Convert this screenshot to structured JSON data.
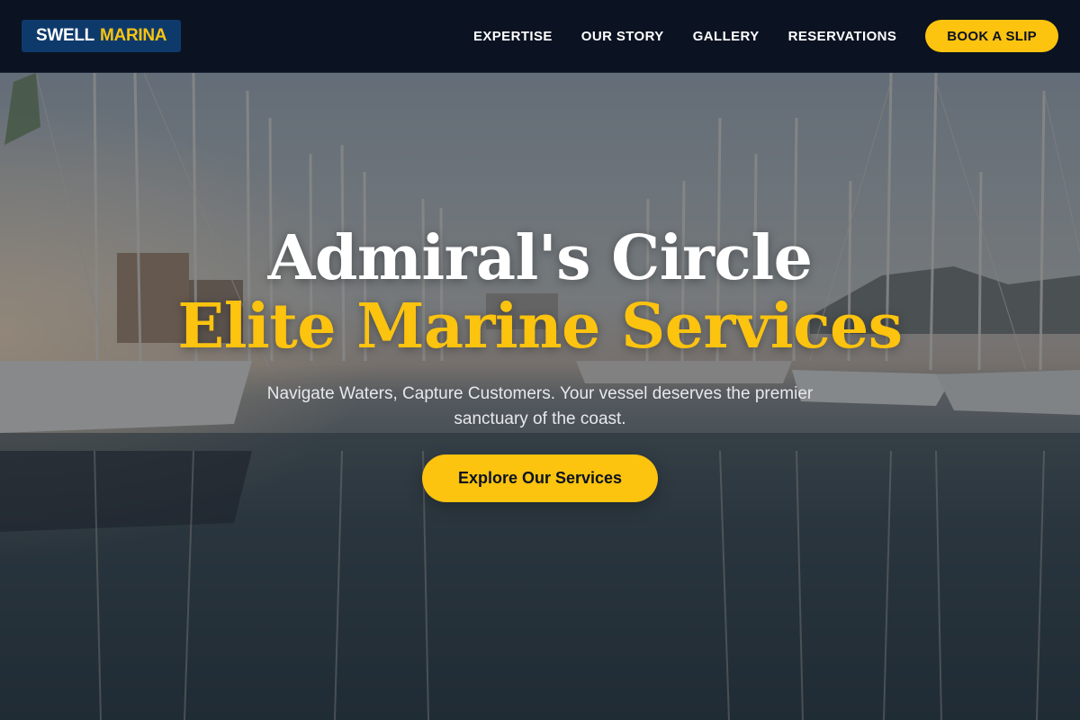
{
  "header": {
    "logo": {
      "word1": "SWELL",
      "word2": "MARINA"
    },
    "nav": [
      {
        "label": "EXPERTISE"
      },
      {
        "label": "OUR STORY"
      },
      {
        "label": "GALLERY"
      },
      {
        "label": "RESERVATIONS"
      }
    ],
    "cta_label": "BOOK A SLIP"
  },
  "hero": {
    "title_line1": "Admiral's Circle",
    "title_line2": "Elite Marine Services",
    "subtitle": "Navigate Waters, Capture Customers. Your vessel deserves the premier sanctuary of the coast.",
    "cta_label": "Explore Our Services",
    "background_image": "marina-sailboat-masts-photo"
  },
  "colors": {
    "accent": "#fcc30f",
    "header_bg": "#0b1221",
    "logo_bg": "#0e3a6b",
    "text_light": "#ffffff"
  }
}
